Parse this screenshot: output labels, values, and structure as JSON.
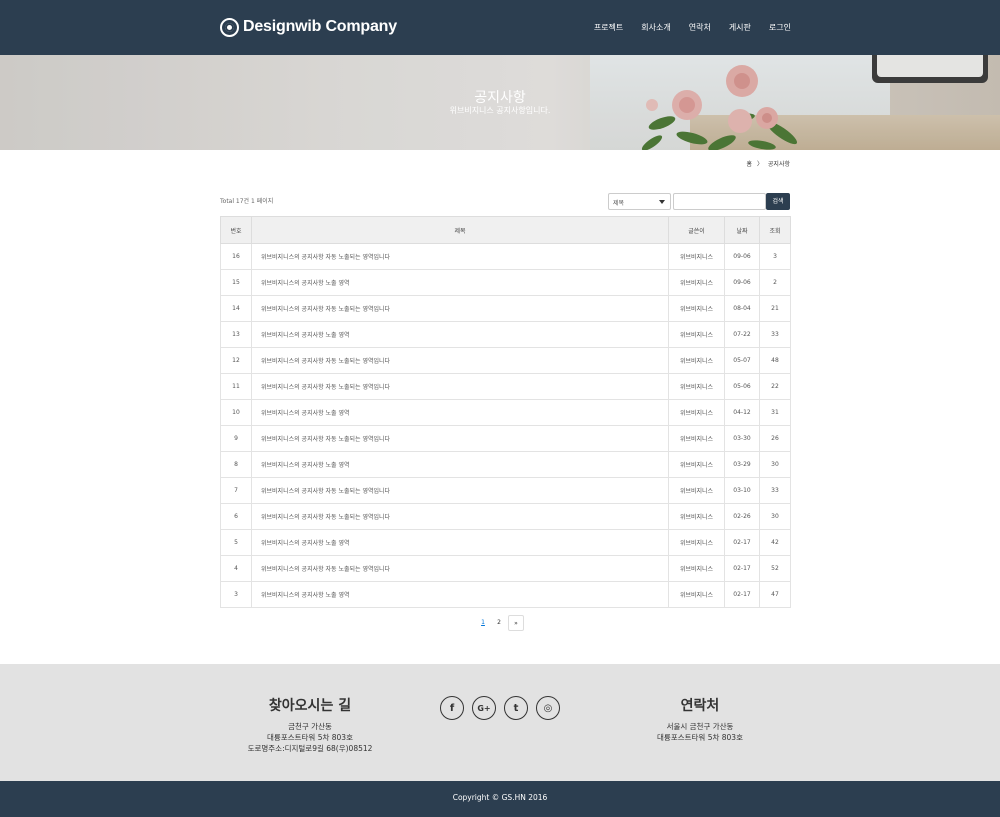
{
  "header": {
    "logo_icon": "target-circle-icon",
    "brand": "Designwib Company",
    "nav": [
      "프로젝트",
      "회사소개",
      "연락처",
      "게시판",
      "로그인"
    ]
  },
  "hero": {
    "title": "공지사항",
    "subtitle": "위브비지니스 공지사항입니다."
  },
  "breadcrumb": {
    "home": "홈",
    "separator": "〉",
    "current": "공지사항"
  },
  "toolbar": {
    "total": "Total 17건 1 페이지",
    "select_value": "제목",
    "search_value": "",
    "search_button": "검색"
  },
  "table": {
    "columns": [
      "번호",
      "제목",
      "글쓴이",
      "날짜",
      "조회"
    ],
    "rows": [
      {
        "no": "16",
        "subject": "위브비지니스의 공지사항 자동 노출되는 영역입니다",
        "writer": "위브비지니스",
        "date": "09-06",
        "views": "3"
      },
      {
        "no": "15",
        "subject": "위브비지니스의 공지사항 노출 영역",
        "writer": "위브비지니스",
        "date": "09-06",
        "views": "2"
      },
      {
        "no": "14",
        "subject": "위브비지니스의 공지사항 자동 노출되는 영역입니다",
        "writer": "위브비지니스",
        "date": "08-04",
        "views": "21"
      },
      {
        "no": "13",
        "subject": "위브비지니스의 공지사항 노출 영역",
        "writer": "위브비지니스",
        "date": "07-22",
        "views": "33"
      },
      {
        "no": "12",
        "subject": "위브비지니스의 공지사항 자동 노출되는 영역입니다",
        "writer": "위브비지니스",
        "date": "05-07",
        "views": "48"
      },
      {
        "no": "11",
        "subject": "위브비지니스의 공지사항 자동 노출되는 영역입니다",
        "writer": "위브비지니스",
        "date": "05-06",
        "views": "22"
      },
      {
        "no": "10",
        "subject": "위브비지니스의 공지사항 노출 영역",
        "writer": "위브비지니스",
        "date": "04-12",
        "views": "31"
      },
      {
        "no": "9",
        "subject": "위브비지니스의 공지사항 자동 노출되는 영역입니다",
        "writer": "위브비지니스",
        "date": "03-30",
        "views": "26"
      },
      {
        "no": "8",
        "subject": "위브비지니스의 공지사항 노출 영역",
        "writer": "위브비지니스",
        "date": "03-29",
        "views": "30"
      },
      {
        "no": "7",
        "subject": "위브비지니스의 공지사항 자동 노출되는 영역입니다",
        "writer": "위브비지니스",
        "date": "03-10",
        "views": "33"
      },
      {
        "no": "6",
        "subject": "위브비지니스의 공지사항 자동 노출되는 영역입니다",
        "writer": "위브비지니스",
        "date": "02-26",
        "views": "30"
      },
      {
        "no": "5",
        "subject": "위브비지니스의 공지사항 노출 영역",
        "writer": "위브비지니스",
        "date": "02-17",
        "views": "42"
      },
      {
        "no": "4",
        "subject": "위브비지니스의 공지사항 자동 노출되는 영역입니다",
        "writer": "위브비지니스",
        "date": "02-17",
        "views": "52"
      },
      {
        "no": "3",
        "subject": "위브비지니스의 공지사항 노출 영역",
        "writer": "위브비지니스",
        "date": "02-17",
        "views": "47"
      }
    ]
  },
  "pagination": {
    "pages": [
      "1",
      "2"
    ],
    "current": "1",
    "next": "»"
  },
  "footer": {
    "directions_title": "찾아오시는 길",
    "directions_lines": [
      "금천구 가산동",
      "대륭포스트타워 5차 803호",
      "도로명주소:디지털로9길 68(우)08512"
    ],
    "social_icons": [
      "facebook-icon",
      "google-plus-icon",
      "twitter-icon",
      "instagram-icon"
    ],
    "social_glyphs": [
      "f",
      "G+",
      "t",
      "◎"
    ],
    "contact_title": "연락처",
    "contact_lines": [
      "서울시 금천구 가산동",
      "대륭포스트타워 5차 803호"
    ],
    "copyright": "Copyright © GS.HN 2016"
  },
  "colors": {
    "header_bg": "#2c3e50",
    "footer_bg": "#e2e2e2",
    "copy_bg": "#2c3e50",
    "accent": "#0275d8"
  }
}
